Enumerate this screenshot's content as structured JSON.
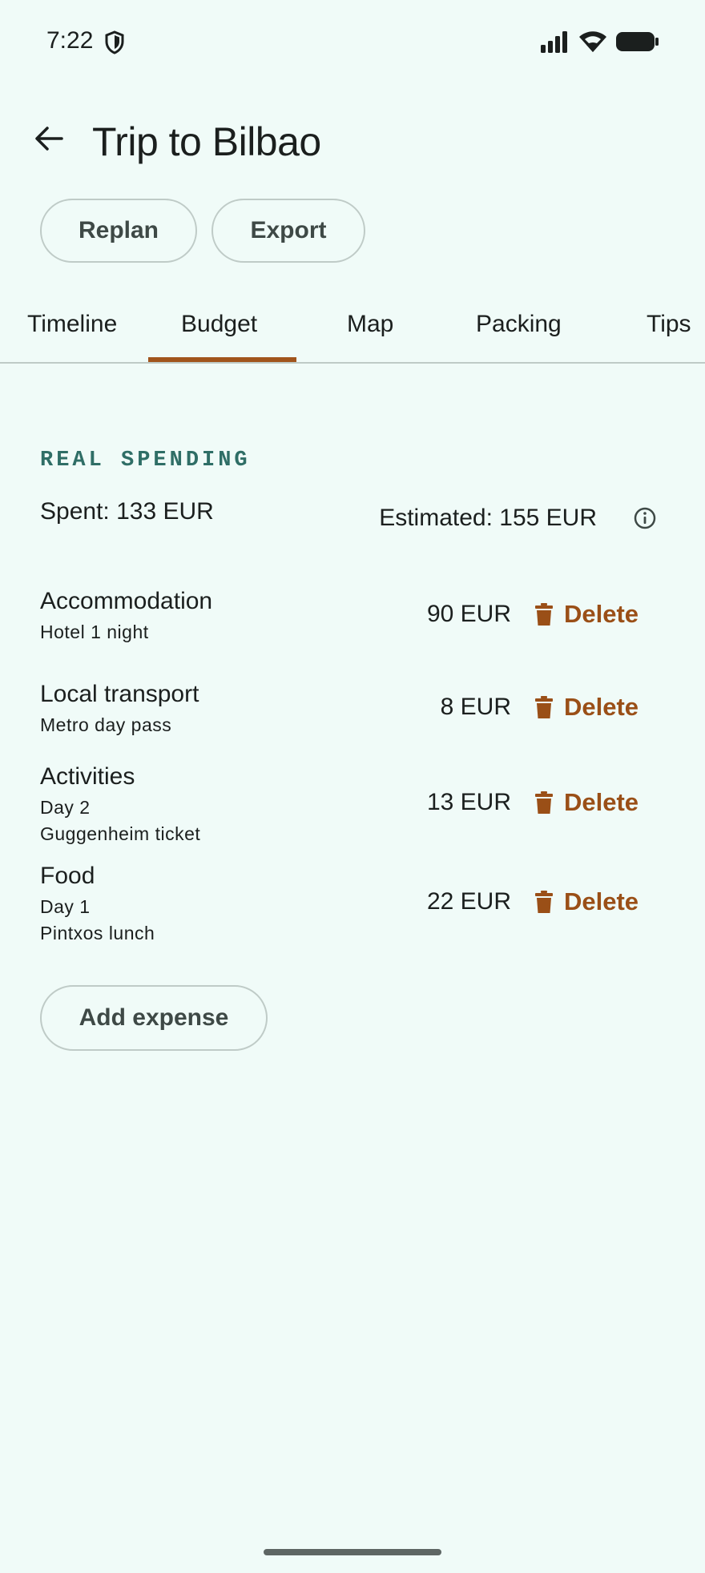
{
  "status_bar": {
    "time": "7:22"
  },
  "app_bar": {
    "title": "Trip to Bilbao"
  },
  "actions": {
    "replan_label": "Replan",
    "export_label": "Export"
  },
  "tabs": [
    {
      "label": "Timeline"
    },
    {
      "label": "Budget",
      "selected": true
    },
    {
      "label": "Map"
    },
    {
      "label": "Packing"
    },
    {
      "label": "Tips"
    }
  ],
  "budget": {
    "section_label": "REAL SPENDING",
    "spent": "Spent: 133 EUR",
    "estimated": "Estimated: 155 EUR",
    "delete_label": "Delete",
    "expenses": [
      {
        "category": "Accommodation",
        "details": [
          "Hotel 1 night"
        ],
        "amount": "90 EUR"
      },
      {
        "category": "Local transport",
        "details": [
          "Metro day pass"
        ],
        "amount": "8 EUR"
      },
      {
        "category": "Activities",
        "details": [
          "Day 2",
          "Guggenheim ticket"
        ],
        "amount": "13 EUR"
      },
      {
        "category": "Food",
        "details": [
          "Day 1",
          "Pintxos lunch"
        ],
        "amount": "22 EUR"
      }
    ],
    "add_label": "Add expense"
  },
  "colors": {
    "accent": "#A0541C",
    "background": "#F0FBF8",
    "section_label": "#2F6E66",
    "delete": "#9A4F17"
  }
}
